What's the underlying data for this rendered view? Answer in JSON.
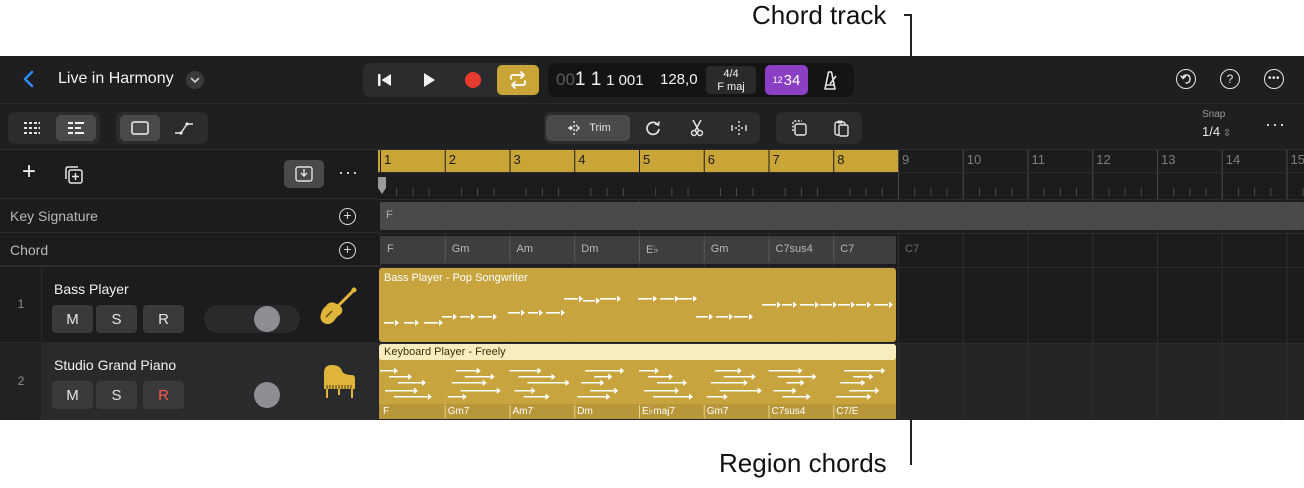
{
  "callouts": {
    "chord_track": "Chord track",
    "region_chords": "Region chords"
  },
  "topbar": {
    "project_title": "Live in Harmony",
    "lcd": {
      "position_dim": "00",
      "position_bar": "1 1",
      "position_sub": "1 001",
      "tempo": "128,0",
      "time_signature": "4/4",
      "key": "F maj"
    },
    "count_in_small": "12",
    "count_in_large": "34",
    "accent_color": "#c9a437",
    "count_in_color": "#8a3fc4",
    "record_color": "#e63a2e"
  },
  "toolbar": {
    "trim_label": "Trim",
    "snap_label": "Snap",
    "snap_value": "1/4"
  },
  "global_tracks": {
    "key_signature_label": "Key Signature",
    "chord_label": "Chord",
    "key_value": "F",
    "chords": [
      "F",
      "Gm",
      "Am",
      "Dm",
      "E♭",
      "Gm",
      "C7sus4",
      "C7",
      "C7"
    ]
  },
  "ruler": {
    "bars": [
      "1",
      "2",
      "3",
      "4",
      "5",
      "6",
      "7",
      "8",
      "9",
      "10",
      "11",
      "12",
      "13",
      "14",
      "15"
    ],
    "cycle_start_bar": 1,
    "cycle_end_bar": 9
  },
  "tracks": [
    {
      "number": "1",
      "name": "Bass Player",
      "mute": "M",
      "solo": "S",
      "record": "R",
      "record_armed": false,
      "icon": "bass-guitar-icon",
      "region_title": "Bass Player - Pop Songwriter",
      "region_color": "#c7a43d"
    },
    {
      "number": "2",
      "name": "Studio Grand Piano",
      "mute": "M",
      "solo": "S",
      "record": "R",
      "record_armed": true,
      "icon": "grand-piano-icon",
      "region_title": "Keyboard Player - Freely",
      "region_color": "#c7a43d",
      "region_chords": [
        "F",
        "Gm7",
        "Am7",
        "Dm",
        "E♭maj7",
        "Gm7",
        "C7sus4",
        "C7/E"
      ]
    }
  ]
}
